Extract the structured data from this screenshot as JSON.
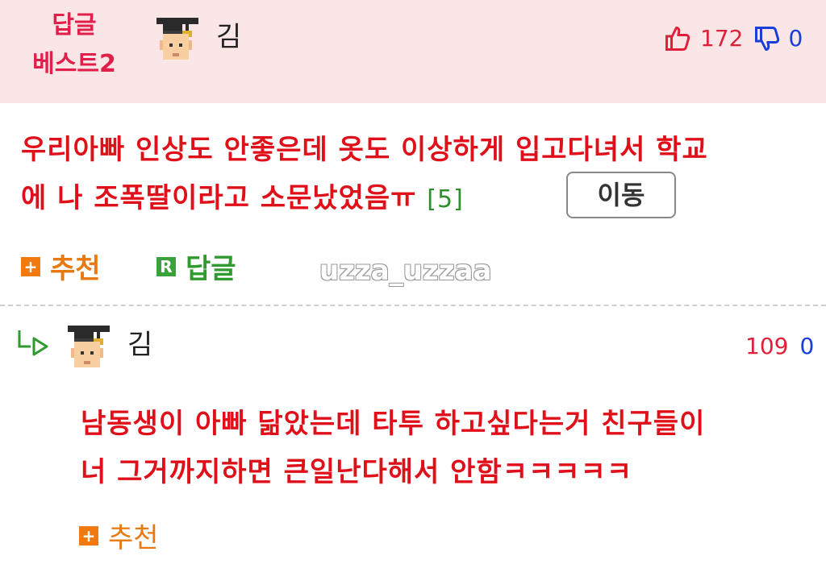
{
  "best_comment": {
    "badge_line1": "답글",
    "badge_line2": "베스트2",
    "author": "김",
    "upvotes": "172",
    "downvotes": "0",
    "text_line1": "우리아빠 인상도 안좋은데 옷도 이상하게 입고다녀서 학교",
    "text_line2": "에 나 조폭딸이라고 소문났었음ㅠ",
    "reply_count": "[5]",
    "move_button": "이동",
    "recommend_label": "추천",
    "reply_label": "답글",
    "recommend_icon_text": "+",
    "reply_icon_text": "R"
  },
  "watermark": "uzza_uzzaa",
  "reply": {
    "author": "김",
    "upvotes": "109",
    "downvotes": "0",
    "text_line1": "남동생이 아빠 닮았는데 타투 하고싶다는거 친구들이",
    "text_line2": "너 그거까지하면 큰일난다해서 안함ㅋㅋㅋㅋㅋ",
    "recommend_label": "추천",
    "recommend_icon_text": "+"
  },
  "colors": {
    "header_bg": "#fae6e6",
    "badge": "#e0204a",
    "body_text": "#e0101a",
    "upvote": "#e0203a",
    "downvote": "#1a3fd8",
    "recommend": "#e87810",
    "reply": "#2f9a2f"
  },
  "icons": [
    "graduate-avatar-icon",
    "thumbs-up-icon",
    "thumbs-down-icon",
    "plus-icon",
    "reply-r-icon",
    "reply-arrow-icon"
  ]
}
